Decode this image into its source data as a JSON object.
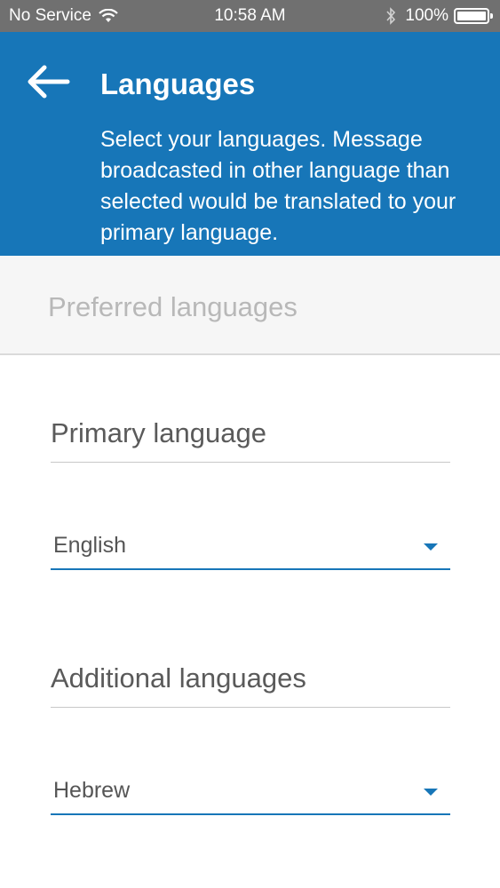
{
  "status_bar": {
    "carrier": "No Service",
    "time": "10:58 AM",
    "battery": "100%"
  },
  "header": {
    "title": "Languages",
    "description": "Select your languages. Message broadcasted in other language than selected would be translated to your primary language."
  },
  "section": {
    "title": "Preferred languages"
  },
  "primary": {
    "label": "Primary language",
    "value": "English"
  },
  "additional": {
    "label": "Additional languages",
    "value": "Hebrew"
  },
  "colors": {
    "header_bg": "#1776b8",
    "accent": "#1776b8",
    "status_bar_bg": "#707070"
  }
}
